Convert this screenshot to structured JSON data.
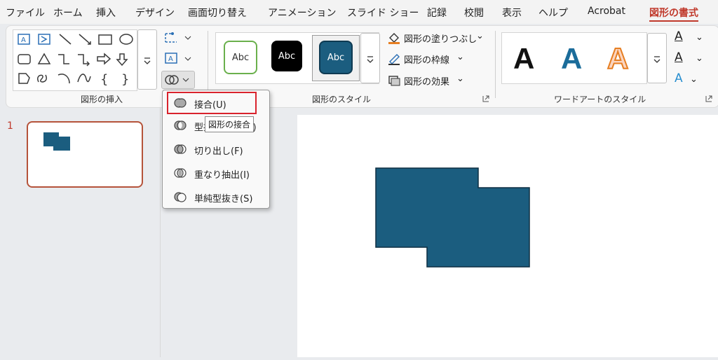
{
  "menu": {
    "items": [
      "ファイル",
      "ホーム",
      "挿入",
      "デザイン",
      "画面切り替え",
      "アニメーション",
      "スライド ショー",
      "記録",
      "校閲",
      "表示",
      "ヘルプ",
      "Acrobat",
      "図形の書式"
    ],
    "active_index": 12
  },
  "ribbon": {
    "insert_shapes_label": "図形の挿入",
    "shape_styles_label": "図形のスタイル",
    "wordart_styles_label": "ワードアートのスタイル",
    "style_samples": [
      "Abc",
      "Abc",
      "Abc"
    ],
    "shape_fill": "図形の塗りつぶし",
    "shape_outline": "図形の枠線",
    "shape_effects": "図形の効果",
    "wordart_letters": [
      "A",
      "A",
      "A"
    ],
    "text_buttons": [
      "A",
      "A",
      "A"
    ]
  },
  "merge_menu": {
    "items": [
      "接合(U)",
      "型抜き/合成(C)",
      "切り出し(F)",
      "重なり抽出(I)",
      "単純型抜き(S)"
    ],
    "highlighted_index": 0,
    "tooltip": "図形の接合"
  },
  "slides": {
    "number": "1"
  },
  "colors": {
    "accent": "#c0392b",
    "shape_fill": "#1b5d7f",
    "highlight_border": "#d9232d"
  }
}
